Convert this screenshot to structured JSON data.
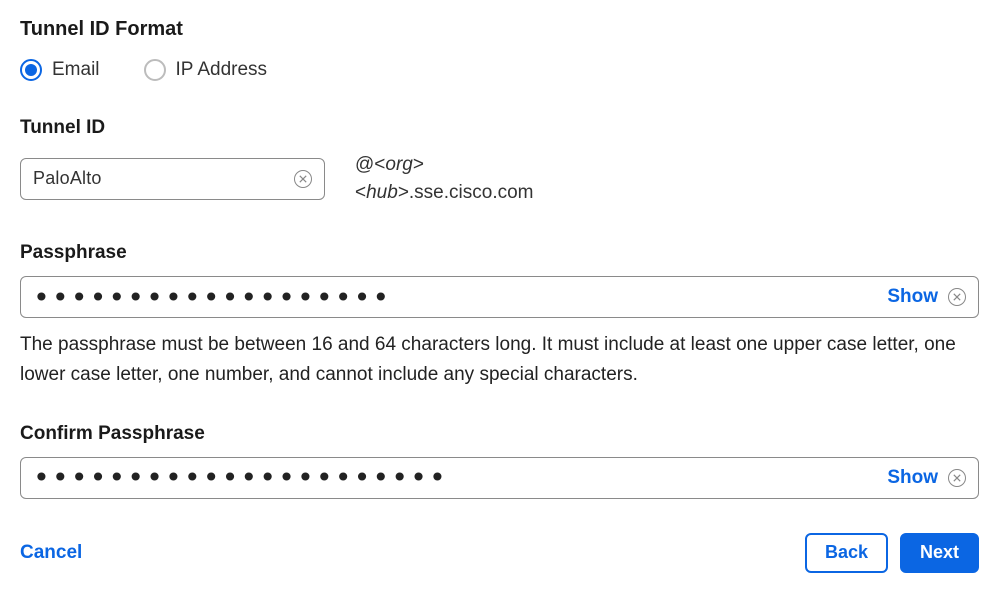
{
  "section_title": "Tunnel ID Format",
  "radios": {
    "email": "Email",
    "ip": "IP Address",
    "selected": "email"
  },
  "tunnel_id": {
    "label": "Tunnel ID",
    "value": "PaloAlto",
    "suffix_line1_prefix": "@<",
    "suffix_line1_var": "org",
    "suffix_line1_suffix": ">",
    "suffix_line2_prefix": "<",
    "suffix_line2_var": "hub",
    "suffix_line2_suffix": ">.sse.cisco.com"
  },
  "passphrase": {
    "label": "Passphrase",
    "value": "•••••••••••••••••••",
    "show_label": "Show",
    "helper": "The passphrase must be between 16 and 64 characters long. It must include at least one upper case letter, one lower case letter, one number, and cannot include any special characters."
  },
  "confirm_passphrase": {
    "label": "Confirm Passphrase",
    "value": "••••••••••••••••••••••",
    "show_label": "Show"
  },
  "footer": {
    "cancel": "Cancel",
    "back": "Back",
    "next": "Next"
  }
}
